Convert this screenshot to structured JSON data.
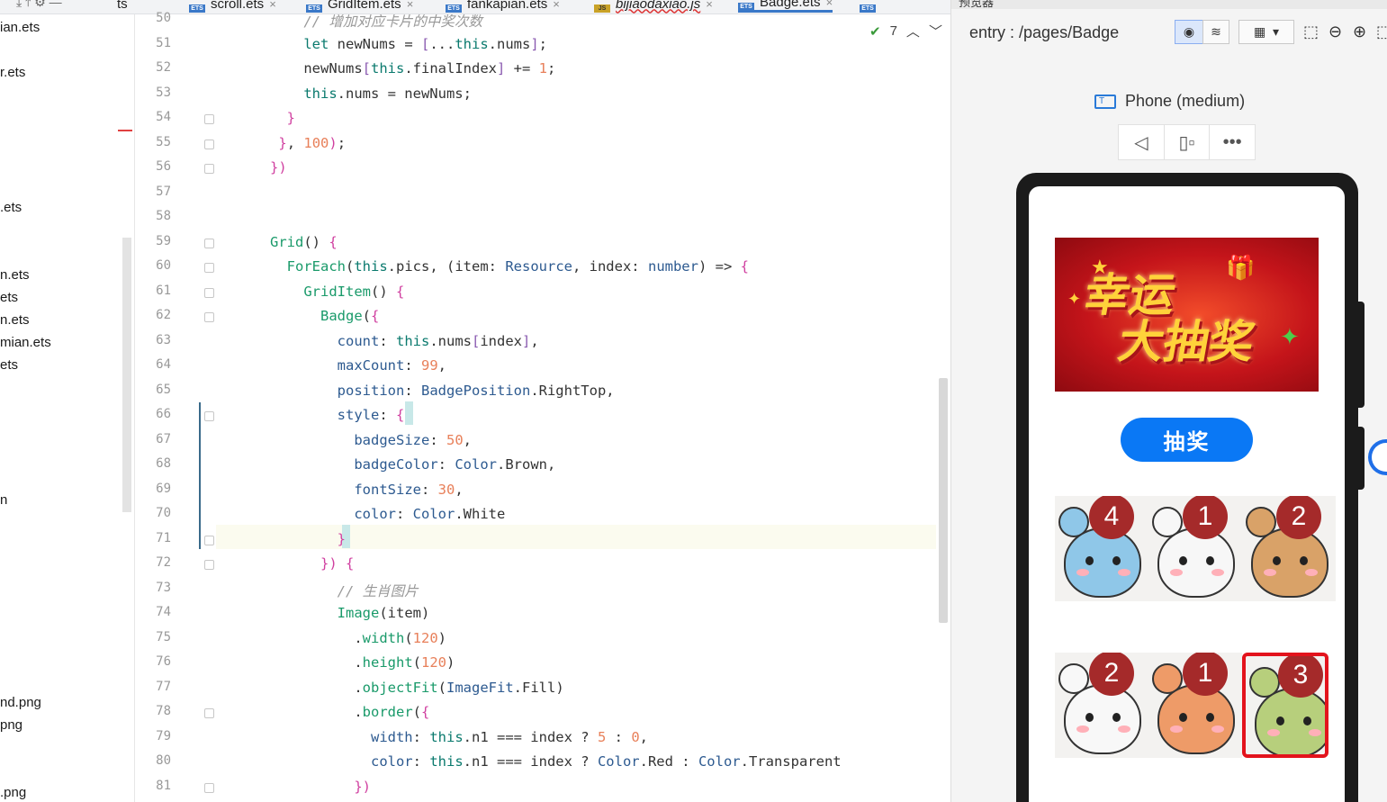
{
  "tabs": [
    {
      "label": "ts",
      "type": "ets"
    },
    {
      "label": "scroll.ets",
      "type": "ets"
    },
    {
      "label": "GridItem.ets",
      "type": "ets"
    },
    {
      "label": "fankapian.ets",
      "type": "ets"
    },
    {
      "label": "bijiaodaxiao.js",
      "type": "js"
    },
    {
      "label": "Badge.ets",
      "type": "ets",
      "active": true
    },
    {
      "label": "",
      "type": "ets"
    }
  ],
  "tree": [
    "ian.ets",
    "r.ets",
    ".ets",
    "n.ets",
    "ets",
    "n.ets",
    "mian.ets",
    "ets",
    "n",
    "nd.png",
    "png",
    ".png"
  ],
  "editor": {
    "problems_count": "7",
    "lines": [
      {
        "n": "50",
        "html": "<span class='cm'>    // 增加对应卡片的中奖次数</span>"
      },
      {
        "n": "51",
        "html": "    <span class='kw'>let</span> newNums = <span class='pun'>[</span>...<span class='kw'>this</span>.nums<span class='pun'>]</span>;"
      },
      {
        "n": "52",
        "html": "    newNums<span class='pun'>[</span><span class='kw'>this</span>.finalIndex<span class='pun'>]</span> += <span class='num'>1</span>;"
      },
      {
        "n": "53",
        "html": "    <span class='kw'>this</span>.nums = newNums;"
      },
      {
        "n": "54",
        "html": "  <span class='br'>}</span>"
      },
      {
        "n": "55",
        "html": " <span class='br'>}</span>, <span class='num'>100</span><span class='br'>)</span>;"
      },
      {
        "n": "56",
        "html": "<span class='br'>})</span>"
      },
      {
        "n": "57",
        "html": ""
      },
      {
        "n": "58",
        "html": ""
      },
      {
        "n": "59",
        "html": "<span class='fn'>Grid</span>() <span class='br'>{</span>"
      },
      {
        "n": "60",
        "html": "  <span class='fn'>ForEach</span>(<span class='kw'>this</span>.pics, (item: <span class='ty'>Resource</span>, index: <span class='ty'>number</span>) => <span class='br'>{</span>"
      },
      {
        "n": "61",
        "html": "    <span class='fn'>GridItem</span>() <span class='br'>{</span>"
      },
      {
        "n": "62",
        "html": "      <span class='fn'>Badge</span>(<span class='br'>{</span>"
      },
      {
        "n": "63",
        "html": "        <span class='prop'>count</span>: <span class='kw'>this</span>.nums<span class='pun'>[</span>index<span class='pun'>]</span>,"
      },
      {
        "n": "64",
        "html": "        <span class='prop'>maxCount</span>: <span class='num'>99</span>,"
      },
      {
        "n": "65",
        "html": "        <span class='prop'>position</span>: <span class='ty'>BadgePosition</span>.RightTop,"
      },
      {
        "n": "66",
        "html": "        <span class='prop'>style</span>: <span class='br'>{</span>"
      },
      {
        "n": "67",
        "html": "          <span class='prop'>badgeSize</span>: <span class='num'>50</span>,"
      },
      {
        "n": "68",
        "html": "          <span class='prop'>badgeColor</span>: <span class='ty'>Color</span>.Brown,"
      },
      {
        "n": "69",
        "html": "          <span class='prop'>fontSize</span>: <span class='num'>30</span>,"
      },
      {
        "n": "70",
        "html": "          <span class='prop'>color</span>: <span class='ty'>Color</span>.White"
      },
      {
        "n": "71",
        "html": "        <span class='br'>}</span>"
      },
      {
        "n": "72",
        "html": "      <span class='br'>})</span> <span class='br'>{</span>"
      },
      {
        "n": "73",
        "html": "        <span class='cm'>// 生肖图片</span>"
      },
      {
        "n": "74",
        "html": "        <span class='fn'>Image</span>(item)"
      },
      {
        "n": "75",
        "html": "          .<span class='fn'>width</span>(<span class='num'>120</span>)"
      },
      {
        "n": "76",
        "html": "          .<span class='fn'>height</span>(<span class='num'>120</span>)"
      },
      {
        "n": "77",
        "html": "          .<span class='fn'>objectFit</span>(<span class='ty'>ImageFit</span>.Fill)"
      },
      {
        "n": "78",
        "html": "          .<span class='fn'>border</span>(<span class='br'>{</span>"
      },
      {
        "n": "79",
        "html": "            <span class='prop'>width</span>: <span class='kw'>this</span>.n1 === index ? <span class='num'>5</span> : <span class='num'>0</span>,"
      },
      {
        "n": "80",
        "html": "            <span class='prop'>color</span>: <span class='kw'>this</span>.n1 === index ? <span class='ty'>Color</span>.Red : <span class='ty'>Color</span>.Transparent"
      },
      {
        "n": "81",
        "html": "          <span class='br'>})</span>"
      }
    ]
  },
  "previewer": {
    "title": "预览器",
    "route": "entry : /pages/Badge",
    "device": "Phone (medium)",
    "banner_text": [
      "幸运",
      "大抽奖"
    ],
    "draw_button": "抽奖",
    "cells": [
      {
        "animal": "mouse",
        "count": "4",
        "color": "#8fc7e8",
        "selected": false
      },
      {
        "animal": "ox",
        "count": "1",
        "color": "#f7f7f7",
        "selected": false
      },
      {
        "animal": "tiger",
        "count": "2",
        "color": "#d9a268",
        "selected": false
      },
      {
        "animal": "rabbit",
        "count": "2",
        "color": "#f8f8f8",
        "selected": false
      },
      {
        "animal": "dragon",
        "count": "1",
        "color": "#ee9b68",
        "selected": false
      },
      {
        "animal": "snake",
        "count": "3",
        "color": "#b7cf7c",
        "selected": true
      }
    ]
  }
}
